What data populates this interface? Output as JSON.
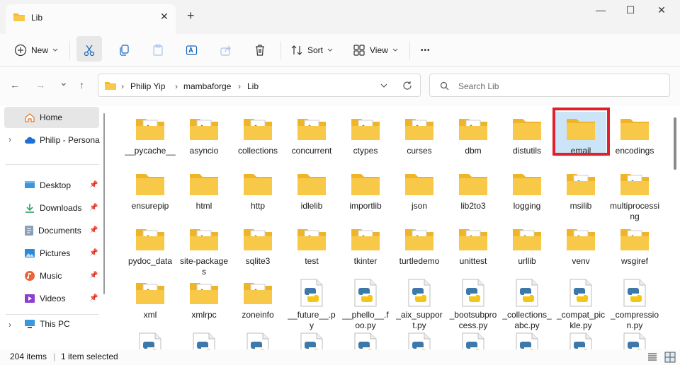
{
  "window": {
    "tab_title": "Lib",
    "close_tab": "✕",
    "new_tab": "+",
    "minimize": "—",
    "maximize": "☐",
    "close": "✕"
  },
  "toolbar": {
    "new_label": "New",
    "sort_label": "Sort",
    "view_label": "View",
    "more_label": "•••"
  },
  "nav": {
    "back": "←",
    "forward": "→",
    "recent": "⌄",
    "up": "↑",
    "breadcrumb": [
      "Philip Yip",
      "mambaforge",
      "Lib"
    ],
    "search_placeholder": "Search Lib"
  },
  "sidebar": {
    "home": "Home",
    "onedrive": "Philip - Persona",
    "pinned": [
      "Desktop",
      "Downloads",
      "Documents",
      "Pictures",
      "Music",
      "Videos"
    ],
    "this_pc": "This PC"
  },
  "content": {
    "row1": [
      "__pycache__",
      "asyncio",
      "collections",
      "concurrent",
      "ctypes",
      "curses",
      "dbm",
      "distutils",
      "email",
      "encodings"
    ],
    "row2": [
      "ensurepip",
      "html",
      "http",
      "idlelib",
      "importlib",
      "json",
      "lib2to3",
      "logging",
      "msilib",
      "multiprocessing"
    ],
    "row3": [
      "pydoc_data",
      "site-packages",
      "sqlite3",
      "test",
      "tkinter",
      "turtledemo",
      "unittest",
      "urllib",
      "venv",
      "wsgiref"
    ],
    "row4": [
      "xml",
      "xmlrpc",
      "zoneinfo",
      "__future__.py",
      "__phello__.foo.py",
      "_aix_support.py",
      "_bootsubprocess.py",
      "_collections_abc.py",
      "_compat_pickle.py",
      "_compression.py"
    ]
  },
  "status": {
    "count": "204 items",
    "selected": "1 item selected"
  },
  "colors": {
    "accent": "#e0202a",
    "folder": "#f8c948"
  }
}
